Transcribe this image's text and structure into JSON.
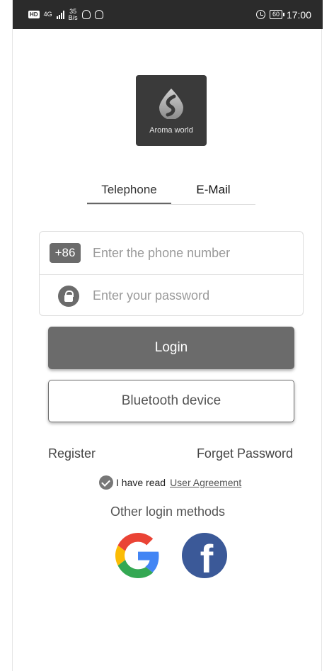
{
  "status_bar": {
    "hd": "HD",
    "network": "4G",
    "speed_value": "35",
    "speed_unit": "B/s",
    "battery": "60",
    "time": "17:00"
  },
  "logo": {
    "brand": "Aroma world"
  },
  "tabs": [
    {
      "label": "Telephone",
      "active": true
    },
    {
      "label": "E-Mail",
      "active": false
    }
  ],
  "form": {
    "country_code": "+86",
    "phone_placeholder": "Enter the phone number",
    "password_placeholder": "Enter your password"
  },
  "buttons": {
    "login": "Login",
    "bluetooth": "Bluetooth device"
  },
  "links": {
    "register": "Register",
    "forget_password": "Forget Password"
  },
  "agreement": {
    "checked": true,
    "text": "I have read",
    "link": "User Agreement"
  },
  "other_login": {
    "title": "Other login methods",
    "providers": [
      "google-icon",
      "facebook-icon"
    ]
  },
  "colors": {
    "primary_gray": "#6b6b6b",
    "status_bar": "#2b2b2b",
    "facebook": "#3b5998"
  }
}
